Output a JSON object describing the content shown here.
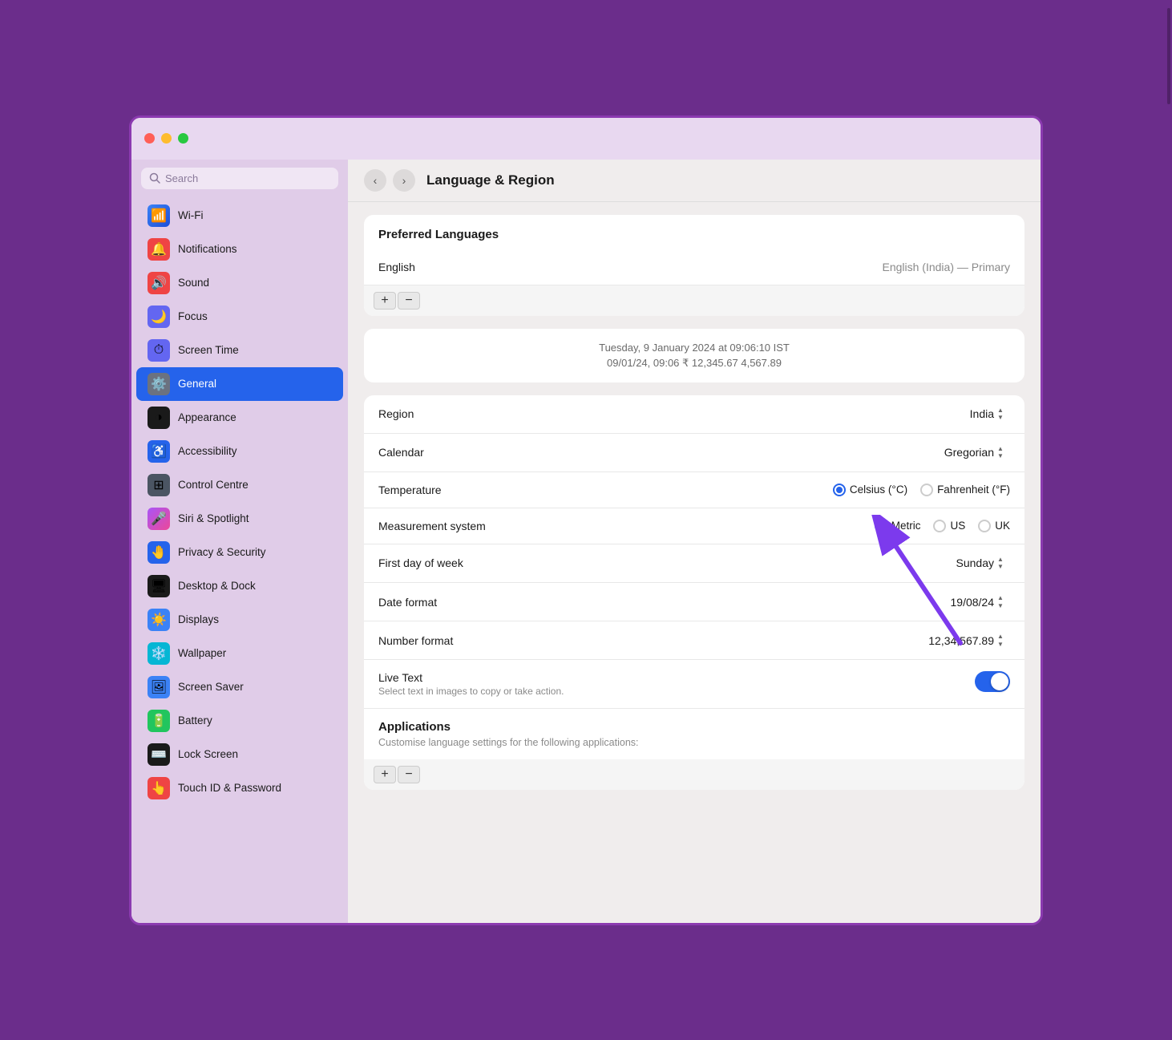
{
  "window": {
    "title": "Language & Region"
  },
  "titlebar": {
    "close": "close",
    "minimize": "minimize",
    "maximize": "maximize"
  },
  "sidebar": {
    "search_placeholder": "Search",
    "items": [
      {
        "id": "wifi",
        "label": "Wi-Fi",
        "icon": "📶",
        "iconClass": "icon-wifi",
        "active": false
      },
      {
        "id": "notifications",
        "label": "Notifications",
        "icon": "🔔",
        "iconClass": "icon-notifications",
        "active": false
      },
      {
        "id": "sound",
        "label": "Sound",
        "icon": "🔊",
        "iconClass": "icon-sound",
        "active": false
      },
      {
        "id": "focus",
        "label": "Focus",
        "icon": "🌙",
        "iconClass": "icon-focus",
        "active": false
      },
      {
        "id": "screentime",
        "label": "Screen Time",
        "icon": "⏱",
        "iconClass": "icon-screentime",
        "active": false
      },
      {
        "id": "general",
        "label": "General",
        "icon": "⚙️",
        "iconClass": "icon-general",
        "active": true
      },
      {
        "id": "appearance",
        "label": "Appearance",
        "icon": "◑",
        "iconClass": "icon-appearance",
        "active": false
      },
      {
        "id": "accessibility",
        "label": "Accessibility",
        "icon": "♿",
        "iconClass": "icon-accessibility",
        "active": false
      },
      {
        "id": "controlcentre",
        "label": "Control Centre",
        "icon": "⊞",
        "iconClass": "icon-controlcentre",
        "active": false
      },
      {
        "id": "siri",
        "label": "Siri & Spotlight",
        "icon": "🎤",
        "iconClass": "icon-siri",
        "active": false
      },
      {
        "id": "privacy",
        "label": "Privacy & Security",
        "icon": "🤚",
        "iconClass": "icon-privacy",
        "active": false
      },
      {
        "id": "desktopDock",
        "label": "Desktop & Dock",
        "icon": "🖥",
        "iconClass": "icon-desktopDock",
        "active": false
      },
      {
        "id": "displays",
        "label": "Displays",
        "icon": "☀️",
        "iconClass": "icon-displays",
        "active": false
      },
      {
        "id": "wallpaper",
        "label": "Wallpaper",
        "icon": "❄️",
        "iconClass": "icon-wallpaper",
        "active": false
      },
      {
        "id": "screensaver",
        "label": "Screen Saver",
        "icon": "🖼",
        "iconClass": "icon-screensaver",
        "active": false
      },
      {
        "id": "battery",
        "label": "Battery",
        "icon": "🔋",
        "iconClass": "icon-battery",
        "active": false
      },
      {
        "id": "lockscreen",
        "label": "Lock Screen",
        "icon": "⌨️",
        "iconClass": "icon-lockscreen",
        "active": false
      },
      {
        "id": "touchid",
        "label": "Touch ID & Password",
        "icon": "👆",
        "iconClass": "icon-touchid",
        "active": false
      }
    ]
  },
  "nav": {
    "back_label": "‹",
    "forward_label": "›",
    "title": "Language & Region"
  },
  "preferred_languages": {
    "section_title": "Preferred Languages",
    "language": "English",
    "language_value": "English (India) — Primary",
    "add_btn": "+",
    "remove_btn": "−"
  },
  "preview": {
    "datetime": "Tuesday, 9 January 2024 at 09:06:10 IST",
    "numbers": "09/01/24, 09:06    ₹ 12,345.67    4,567.89"
  },
  "settings": {
    "region_label": "Region",
    "region_value": "India",
    "calendar_label": "Calendar",
    "calendar_value": "Gregorian",
    "temperature_label": "Temperature",
    "temp_celsius": "Celsius (°C)",
    "temp_fahrenheit": "Fahrenheit (°F)",
    "measurement_label": "Measurement system",
    "measure_metric": "Metric",
    "measure_us": "US",
    "measure_uk": "UK",
    "firstday_label": "First day of week",
    "firstday_value": "Sunday",
    "dateformat_label": "Date format",
    "dateformat_value": "19/08/24",
    "numberformat_label": "Number format",
    "numberformat_value": "12,34,567.89"
  },
  "live_text": {
    "title": "Live Text",
    "description": "Select text in images to copy or take action.",
    "enabled": true
  },
  "applications": {
    "title": "Applications",
    "description": "Customise language settings for the following applications:",
    "add_btn": "+",
    "remove_btn": "−"
  }
}
